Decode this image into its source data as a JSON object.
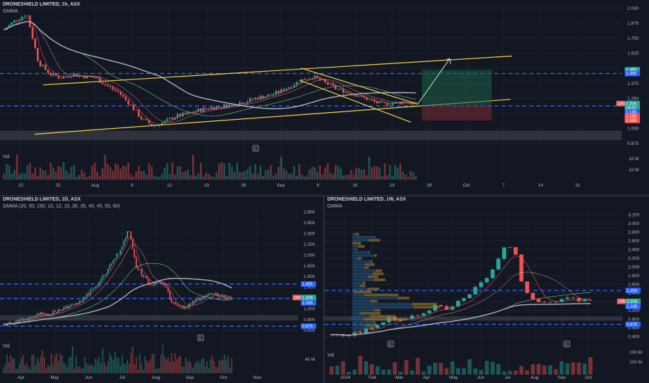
{
  "colors": {
    "background": "#131722",
    "up": "#26a69a",
    "down": "#ef5350",
    "level_line": "#2962ff",
    "channel": "#f5d547",
    "arrow": "#a5d6a7",
    "grid": "#1e222d",
    "profile_up": "#2b6ca3",
    "profile_down": "#a0832f"
  },
  "panes": [
    {
      "id": "pane_1h",
      "title": "DRONESHIELD LIMITED, 1h, ASX",
      "indicator": "GMMA",
      "volume_label": "Vol",
      "price_ticks": [
        "2.000",
        "1.875",
        "1.750",
        "1.625",
        "1.500",
        "1.375",
        "1.250",
        "1.125",
        "1.000",
        "0.875"
      ],
      "volume_ticks": [
        "20 M",
        "10 M"
      ],
      "time_ticks": [
        "22",
        "25",
        "Aug",
        "6",
        "12",
        "19",
        "26",
        "Sep",
        "9",
        "16",
        "23",
        "26",
        "Oct",
        "7",
        "14",
        "21"
      ],
      "price_tags": [
        "1.485",
        "1.455",
        "DRO",
        "1.205",
        "14:57",
        "1.185",
        "1.155",
        "1.065"
      ],
      "marker": "E",
      "chart_data": {
        "type": "candlestick",
        "ylim": [
          0.85,
          2.02
        ],
        "levels": [
          1.455,
          1.185
        ],
        "close_path": [
          1.82,
          1.9,
          1.95,
          1.55,
          1.45,
          1.42,
          1.45,
          1.43,
          1.42,
          1.35,
          1.3,
          1.2,
          1.08,
          1.02,
          1.05,
          1.1,
          1.12,
          1.15,
          1.17,
          1.18,
          1.2,
          1.22,
          1.25,
          1.27,
          1.3,
          1.35,
          1.4,
          1.43,
          1.38,
          1.33,
          1.3,
          1.27,
          1.23,
          1.2,
          1.21,
          1.22,
          1.2
        ]
      }
    },
    {
      "id": "pane_1d",
      "title": "DRONESHIELD LIMITED, 1D, ASX",
      "indicator": "GMMA (20, 50, 150, 10, 12, 15, 30, 35, 40, 45, 50, 60)",
      "volume_label": "Vol",
      "price_ticks": [
        "2.800",
        "2.600",
        "2.400",
        "2.200",
        "2.000",
        "1.800",
        "1.600",
        "1.400",
        "1.200",
        "1.000",
        "0.800",
        "0.600"
      ],
      "volume_ticks": [
        "40 M"
      ],
      "time_ticks": [
        "Apr",
        "May",
        "Jun",
        "Jul",
        "Aug",
        "Sep",
        "Oct",
        "Nov"
      ],
      "price_tags": [
        "1.455",
        "DRO",
        "1.205",
        "1.185",
        "0.675"
      ],
      "marker": "E",
      "chart_data": {
        "type": "candlestick",
        "ylim": [
          0.55,
          2.85
        ],
        "levels": [
          1.455,
          1.185,
          0.675
        ],
        "close_path": [
          0.7,
          0.72,
          0.78,
          0.8,
          0.85,
          0.9,
          0.88,
          0.95,
          1.0,
          1.05,
          1.1,
          1.2,
          1.35,
          1.5,
          1.7,
          1.9,
          2.1,
          2.5,
          1.8,
          1.6,
          1.45,
          1.5,
          1.4,
          1.1,
          1.0,
          1.05,
          1.15,
          1.2,
          1.3,
          1.25,
          1.2,
          1.2
        ]
      }
    },
    {
      "id": "pane_1w",
      "title": "DRONESHIELD LIMITED, 1W, ASX",
      "indicator": "GMMA",
      "volume_label": "Vol",
      "price_ticks": [
        "3.200",
        "3.000",
        "2.800",
        "2.600",
        "2.400",
        "2.200",
        "2.000",
        "1.800",
        "1.600",
        "1.400",
        "1.200",
        "1.000",
        "0.800",
        "0.600",
        "0.400"
      ],
      "volume_ticks": [
        "200 M",
        "100 M"
      ],
      "time_ticks": [
        "2024",
        "Feb",
        "Mar",
        "Apr",
        "May",
        "Jun",
        "Jul",
        "Aug",
        "Sep",
        "Oct"
      ],
      "price_tags": [
        "1.455",
        "DRO",
        "1.205",
        "1.185",
        "0.675"
      ],
      "marker": "E",
      "chart_data": {
        "type": "candlestick",
        "ylim": [
          0.32,
          3.3
        ],
        "levels": [
          1.455,
          0.675
        ],
        "close_path": [
          0.45,
          0.42,
          0.43,
          0.5,
          0.6,
          0.7,
          0.8,
          0.78,
          0.85,
          0.9,
          1.0,
          1.1,
          1.0,
          1.15,
          1.3,
          1.5,
          1.7,
          2.0,
          2.4,
          2.5,
          1.5,
          1.3,
          1.15,
          1.2,
          1.25,
          1.3,
          1.2,
          1.2
        ]
      }
    }
  ]
}
